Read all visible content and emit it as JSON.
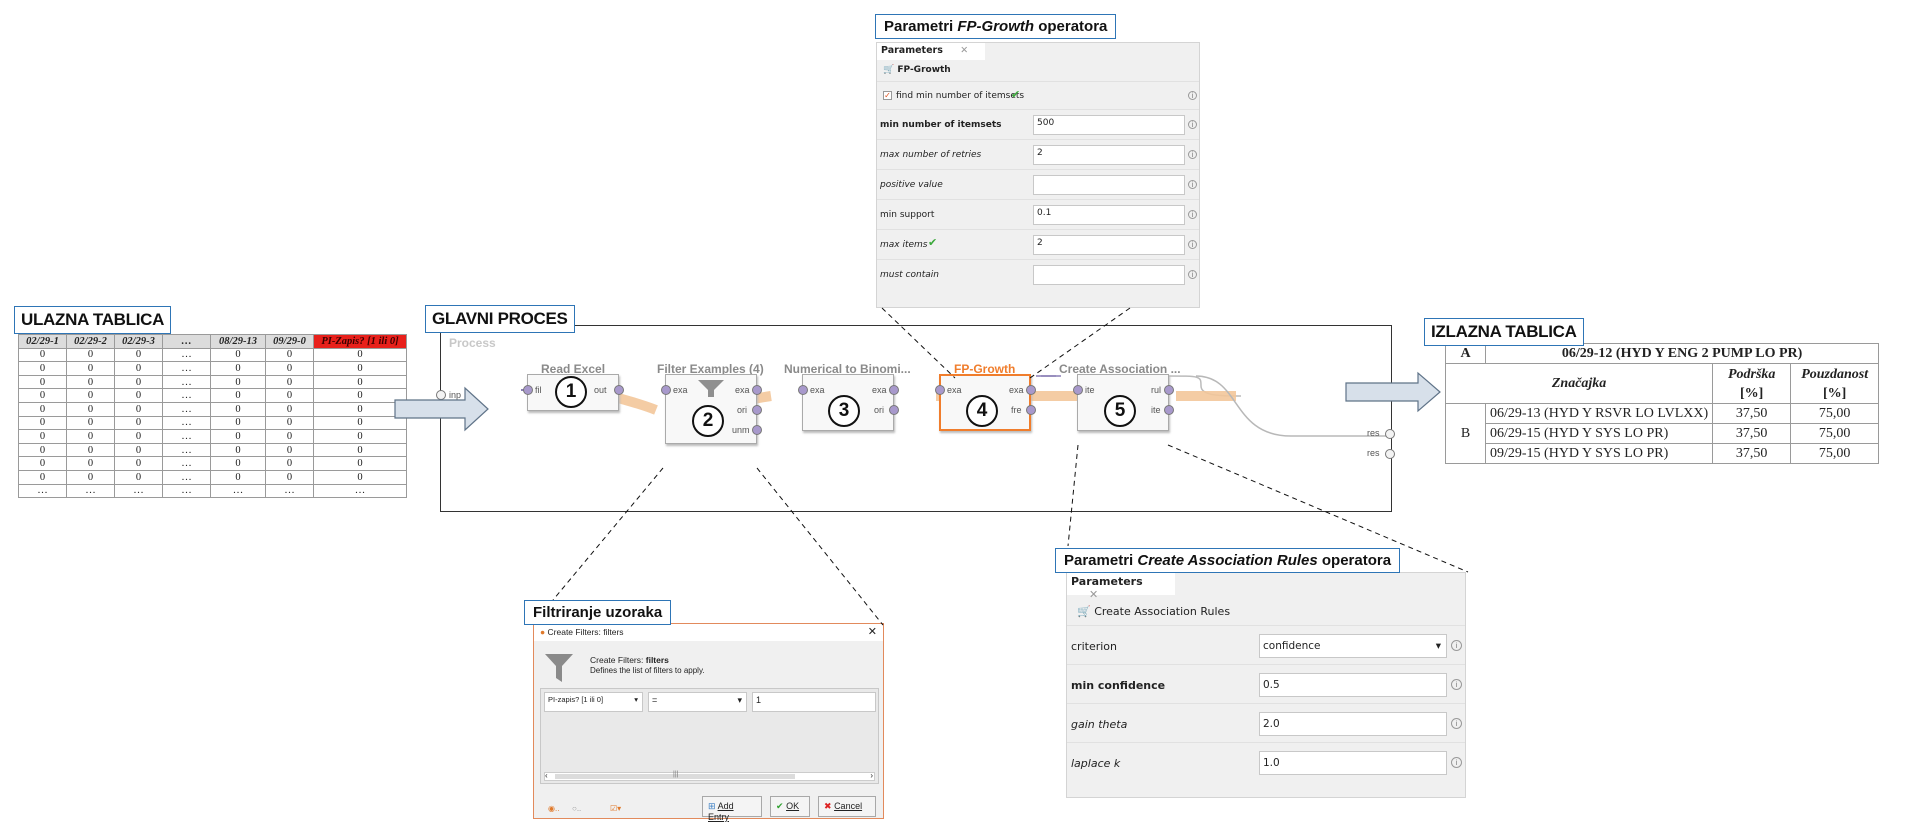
{
  "callouts": {
    "input_table": "ULAZNA TABLICA",
    "main_process": "GLAVNI PROCES",
    "output_table": "IZLAZNA TABLICA",
    "fp_params_pre": "Parametri ",
    "fp_params_em": "FP-Growth",
    "fp_params_post": " operatora",
    "car_params_pre": "Parametri ",
    "car_params_em": "Create Association Rules",
    "car_params_post": " operatora",
    "filter": "Filtriranje uzoraka"
  },
  "input_table": {
    "headers": [
      "02/29-1",
      "02/29-2",
      "02/29-3",
      "…",
      "08/29-13",
      "09/29-0",
      "PI-Zapis? [1 ili 0]"
    ],
    "rows": [
      [
        "0",
        "0",
        "0",
        "…",
        "0",
        "0",
        "0"
      ],
      [
        "0",
        "0",
        "0",
        "…",
        "0",
        "0",
        "0"
      ],
      [
        "0",
        "0",
        "0",
        "…",
        "0",
        "0",
        "0"
      ],
      [
        "0",
        "0",
        "0",
        "…",
        "0",
        "0",
        "0"
      ],
      [
        "0",
        "0",
        "0",
        "…",
        "0",
        "0",
        "0"
      ],
      [
        "0",
        "0",
        "0",
        "…",
        "0",
        "0",
        "0"
      ],
      [
        "0",
        "0",
        "0",
        "…",
        "0",
        "0",
        "0"
      ],
      [
        "0",
        "0",
        "0",
        "…",
        "0",
        "0",
        "0"
      ],
      [
        "0",
        "0",
        "0",
        "…",
        "0",
        "0",
        "0"
      ],
      [
        "0",
        "0",
        "0",
        "…",
        "0",
        "0",
        "0"
      ],
      [
        "…",
        "…",
        "…",
        "…",
        "…",
        "…",
        "…"
      ]
    ]
  },
  "output_table": {
    "col_a": "A",
    "title": "06/29-12 (HYD Y ENG 2 PUMP LO PR)",
    "feature_header": "Značajka",
    "support_header": "Podrška",
    "support_unit": "[%]",
    "confidence_header": "Pouzdanost",
    "confidence_unit": "[%]",
    "row_label": "B",
    "rows": [
      {
        "feature": "06/29-13 (HYD Y RSVR LO LVLXX)",
        "support": "37,50",
        "confidence": "75,00"
      },
      {
        "feature": "06/29-15 (HYD Y SYS LO PR)",
        "support": "37,50",
        "confidence": "75,00"
      },
      {
        "feature": "09/29-15 (HYD Y SYS LO PR)",
        "support": "37,50",
        "confidence": "75,00"
      }
    ]
  },
  "process": {
    "label": "Process",
    "input_port": "inp",
    "res1": "res",
    "res2": "res",
    "operators": [
      {
        "title": "Read Excel",
        "num": "1",
        "in": [
          "fil"
        ],
        "out": [
          "out"
        ]
      },
      {
        "title": "Filter Examples (4)",
        "num": "2",
        "in": [
          "exa"
        ],
        "out": [
          "exa",
          "ori",
          "unm"
        ]
      },
      {
        "title": "Numerical to Binomi...",
        "num": "3",
        "in": [
          "exa"
        ],
        "out": [
          "exa",
          "ori"
        ]
      },
      {
        "title": "FP-Growth",
        "num": "4",
        "in": [
          "exa"
        ],
        "out": [
          "exa",
          "fre"
        ]
      },
      {
        "title": "Create Association ...",
        "num": "5",
        "in": [
          "ite"
        ],
        "out": [
          "rul",
          "ite"
        ]
      }
    ]
  },
  "fp_panel": {
    "tab": "Parameters",
    "close": "✕",
    "operator": "FP-Growth",
    "checkbox_label": "find min number of itemsets",
    "params": [
      {
        "label": "min number of itemsets",
        "value": "500"
      },
      {
        "label": "max number of retries",
        "value": "2"
      },
      {
        "label": "positive value",
        "value": ""
      },
      {
        "label": "min support",
        "value": "0.1"
      },
      {
        "label": "max items",
        "value": "2"
      },
      {
        "label": "must contain",
        "value": ""
      }
    ]
  },
  "car_panel": {
    "tab": "Parameters",
    "close": "✕",
    "operator": "Create Association Rules",
    "params": [
      {
        "label": "criterion",
        "value": "confidence"
      },
      {
        "label": "min confidence",
        "value": "0.5"
      },
      {
        "label": "gain theta",
        "value": "2.0"
      },
      {
        "label": "laplace k",
        "value": "1.0"
      }
    ]
  },
  "dialog": {
    "title": "Create Filters: filters",
    "close": "✕",
    "heading_pre": "Create Filters: ",
    "heading_bold": "filters",
    "desc": "Defines the list of filters to apply.",
    "attribute": "PI-zapis? [1 ili 0]",
    "operator": "=",
    "value": "1",
    "scroll_mark": "|||",
    "add_entry": "Add Entry",
    "ok": "OK",
    "cancel": "Cancel"
  },
  "colors": {
    "callout_border": "#2e75b6",
    "selected_operator": "#f07d2c",
    "input_highlight": "#e8201b",
    "flow": "#f3c79a"
  }
}
